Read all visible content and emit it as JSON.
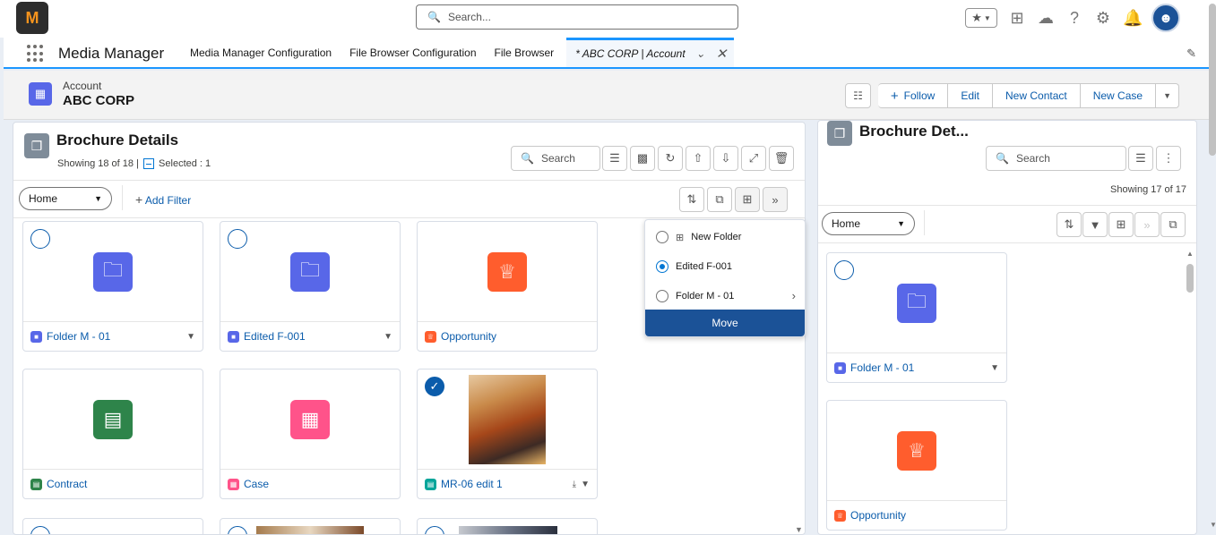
{
  "header_bar": {
    "logo_text": "M",
    "search_placeholder": "Search..."
  },
  "nav": {
    "app_name": "Media Manager",
    "tabs": [
      {
        "label": "Media Manager Configuration"
      },
      {
        "label": "File Browser Configuration"
      },
      {
        "label": "File Browser"
      },
      {
        "label": "* ABC CORP | Account"
      }
    ]
  },
  "record": {
    "type": "Account",
    "name": "ABC CORP",
    "buttons": {
      "follow": "Follow",
      "edit": "Edit",
      "new_contact": "New Contact",
      "new_case": "New Case"
    }
  },
  "left_panel": {
    "title": "Brochure Details",
    "showing": "Showing 18 of 18 |",
    "selected": "Selected : 1",
    "search_placeholder": "Search",
    "folder_select": "Home",
    "add_filter": "Add Filter",
    "cards": [
      {
        "label": "Folder M - 01",
        "icon": "folder-icon",
        "color": "#5867e8"
      },
      {
        "label": "Edited F-001",
        "icon": "folder-icon",
        "color": "#5867e8"
      },
      {
        "label": "Opportunity",
        "icon": "crown-icon",
        "color": "#ff5d2d"
      },
      {
        "label": "Contract",
        "icon": "contract-icon",
        "color": "#2e844a"
      },
      {
        "label": "Case",
        "icon": "case-icon",
        "color": "#ff538a"
      },
      {
        "label": "MR-06 edit 1",
        "icon": "image-file-icon",
        "color": "#06a59a"
      }
    ]
  },
  "move_menu": {
    "new_folder": "New Folder",
    "option_1": "Edited F-001",
    "option_2": "Folder M - 01",
    "move": "Move"
  },
  "right_panel": {
    "title": "Brochure Det...",
    "search_placeholder": "Search",
    "showing": "Showing 17 of 17",
    "folder_select": "Home",
    "cards": [
      {
        "label": "Folder M - 01"
      },
      {
        "label": "Opportunity"
      }
    ]
  }
}
